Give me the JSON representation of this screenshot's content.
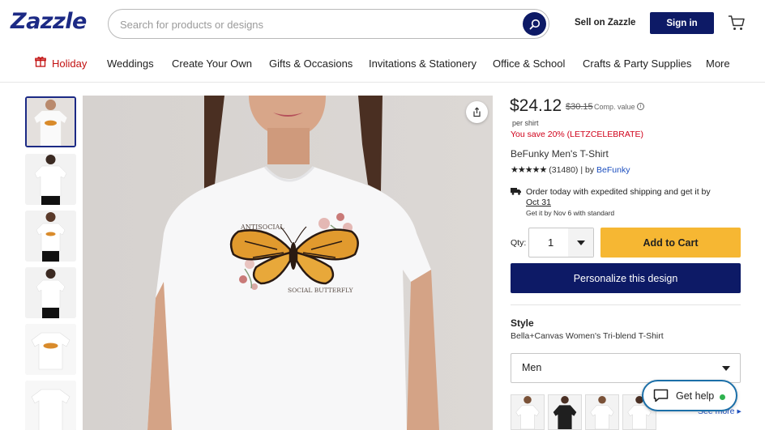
{
  "header": {
    "logo": "Zazzle",
    "search_placeholder": "Search for products or designs",
    "sell_link": "Sell on Zazzle",
    "signin_label": "Sign in"
  },
  "nav": {
    "items": [
      "Holiday",
      "Weddings",
      "Create Your Own",
      "Gifts & Occasions",
      "Invitations & Stationery",
      "Office & School",
      "Crafts & Party Supplies",
      "More"
    ]
  },
  "product": {
    "price": "$24.12",
    "original_price": "$30.15",
    "comp_value_label": "Comp. value",
    "per_unit": "per shirt",
    "savings": "You save 20% (LETZCELEBRATE)",
    "title": "BeFunky Men's T-Shirt",
    "stars": "★★★★★",
    "review_count": "(31480)",
    "by_label": "| by",
    "seller": "BeFunky",
    "image_text_top": "ANTISOCIAL",
    "image_text_bottom": "SOCIAL BUTTERFLY"
  },
  "shipping": {
    "line1": "Order today with expedited shipping and get it by",
    "date": "Oct 31",
    "line2": "Get it by Nov 6 with standard"
  },
  "purchase": {
    "qty_label": "Qty:",
    "qty_value": "1",
    "add_to_cart": "Add to Cart",
    "personalize": "Personalize this design"
  },
  "style": {
    "heading": "Style",
    "value": "Bella+Canvas Women's Tri-blend T-Shirt",
    "selected_option": "Men",
    "see_more": "See more ▸"
  },
  "help": {
    "label": "Get help"
  },
  "colors": {
    "brand_navy": "#0d1a66",
    "logo_blue": "#1c2a85",
    "cart_yellow": "#f6b733",
    "savings_red": "#d0021b",
    "online_green": "#2eb24f"
  }
}
